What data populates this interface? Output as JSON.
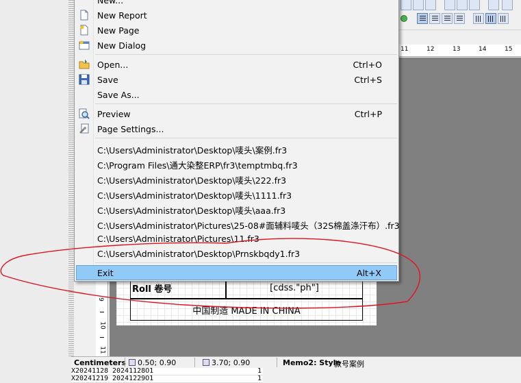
{
  "menu": {
    "items_top": [
      {
        "name": "new-item-partial",
        "label": "New...",
        "shortcut": ""
      },
      {
        "name": "new-report",
        "label": "New Report",
        "shortcut": ""
      },
      {
        "name": "new-page",
        "label": "New Page",
        "shortcut": ""
      },
      {
        "name": "new-dialog",
        "label": "New Dialog",
        "shortcut": ""
      }
    ],
    "open": {
      "label": "Open...",
      "shortcut": "Ctrl+O"
    },
    "save": {
      "label": "Save",
      "shortcut": "Ctrl+S"
    },
    "save_as": {
      "label": "Save As...",
      "shortcut": ""
    },
    "preview": {
      "label": "Preview",
      "shortcut": "Ctrl+P"
    },
    "page_settings": {
      "label": "Page Settings...",
      "shortcut": ""
    },
    "recent_files": [
      "C:\\Users\\Administrator\\Desktop\\唛头\\案例.fr3",
      "C:\\Program Files\\通大染整ERP\\fr3\\temptmbq.fr3",
      "C:\\Users\\Administrator\\Desktop\\唛头\\222.fr3",
      "C:\\Users\\Administrator\\Desktop\\唛头\\1111.fr3",
      "C:\\Users\\Administrator\\Desktop\\唛头\\aaa.fr3",
      "C:\\Users\\Administrator\\Pictures\\25-08#面辅料唛头（32S棉盖涤汗布）.fr3",
      "C:\\Users\\Administrator\\Pictures\\11.fr3",
      "C:\\Users\\Administrator\\Desktop\\Prnskbqdy1.fr3"
    ],
    "exit": {
      "label": "Exit",
      "shortcut": "Alt+X"
    }
  },
  "ruler_top": [
    "11",
    "12",
    "13",
    "14",
    "15"
  ],
  "ruler_left": [
    "9",
    "10",
    "11"
  ],
  "report": {
    "roll_label": "Roll  卷号",
    "ph_field": "[cdss.\"ph\"]",
    "made_in": "中国制造 MADE IN CHINA"
  },
  "status": {
    "units": "Centimeters",
    "position": "0.50; 0.90",
    "size": "3.70; 0.90",
    "object": "Memo2: Style",
    "object_value": "款号案例"
  },
  "data_rows": [
    {
      "a": "X20241128",
      "b": "20241128O1",
      "c": "1"
    },
    {
      "a": "X20241219",
      "b": "20241229O1",
      "c": "1"
    }
  ],
  "colors": {
    "menu_highlight": "#91c9f7",
    "annotation": "#e0141e",
    "workspace": "#808080"
  }
}
